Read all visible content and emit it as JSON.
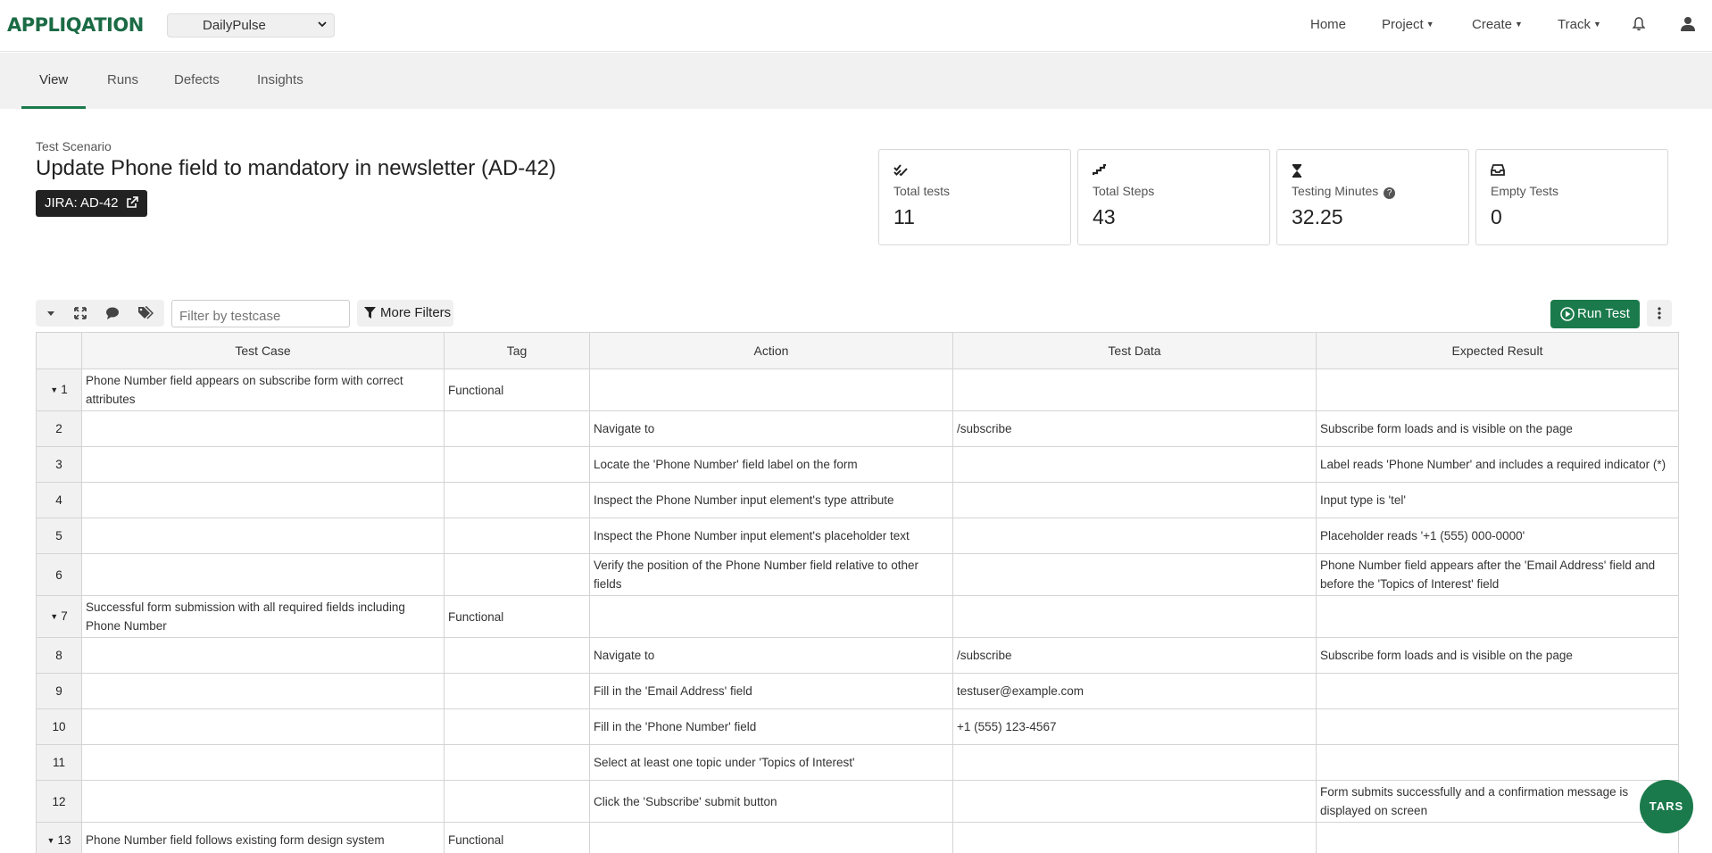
{
  "app": {
    "logo": "APPLIQATION",
    "project_selected": "DailyPulse"
  },
  "topnav": {
    "home": "Home",
    "project": "Project",
    "create": "Create",
    "track": "Track"
  },
  "subnav": [
    "View",
    "Runs",
    "Defects",
    "Insights"
  ],
  "scenario": {
    "label": "Test Scenario",
    "title": "Update Phone field to mandatory in newsletter (AD-42)",
    "jira_badge": "JIRA: AD-42"
  },
  "stats": [
    {
      "label": "Total tests",
      "value": "11",
      "icon": "check-double-icon"
    },
    {
      "label": "Total Steps",
      "value": "43",
      "icon": "stairs-icon"
    },
    {
      "label": "Testing Minutes",
      "value": "32.25",
      "icon": "hourglass-icon"
    },
    {
      "label": "Empty Tests",
      "value": "0",
      "icon": "inbox-icon"
    }
  ],
  "toolbar": {
    "filter_placeholder": "Filter by testcase",
    "more_filters": "More Filters",
    "run_test": "Run Test"
  },
  "table": {
    "headers": [
      "Test Case",
      "Tag",
      "Action",
      "Test Data",
      "Expected Result"
    ],
    "rows": [
      {
        "num": "1",
        "group": true,
        "test_case": "Phone Number field appears on subscribe form with correct attributes",
        "tag": "Functional",
        "action": "",
        "data": "",
        "expected": ""
      },
      {
        "num": "2",
        "group": false,
        "test_case": "",
        "tag": "",
        "action": "Navigate to",
        "data": "/subscribe",
        "expected": "Subscribe form loads and is visible on the page"
      },
      {
        "num": "3",
        "group": false,
        "test_case": "",
        "tag": "",
        "action": "Locate the 'Phone Number' field label on the form",
        "data": "",
        "expected": "Label reads 'Phone Number' and includes a required indicator (*)"
      },
      {
        "num": "4",
        "group": false,
        "test_case": "",
        "tag": "",
        "action": "Inspect the Phone Number input element's type attribute",
        "data": "",
        "expected": "Input type is 'tel'"
      },
      {
        "num": "5",
        "group": false,
        "test_case": "",
        "tag": "",
        "action": "Inspect the Phone Number input element's placeholder text",
        "data": "",
        "expected": "Placeholder reads '+1 (555) 000-0000'"
      },
      {
        "num": "6",
        "group": false,
        "test_case": "",
        "tag": "",
        "action": "Verify the position of the Phone Number field relative to other fields",
        "data": "",
        "expected": "Phone Number field appears after the 'Email Address' field and before the 'Topics of Interest' field"
      },
      {
        "num": "7",
        "group": true,
        "test_case": "Successful form submission with all required fields including Phone Number",
        "tag": "Functional",
        "action": "",
        "data": "",
        "expected": ""
      },
      {
        "num": "8",
        "group": false,
        "test_case": "",
        "tag": "",
        "action": "Navigate to",
        "data": "/subscribe",
        "expected": "Subscribe form loads and is visible on the page"
      },
      {
        "num": "9",
        "group": false,
        "test_case": "",
        "tag": "",
        "action": "Fill in the 'Email Address' field",
        "data": "testuser@example.com",
        "expected": ""
      },
      {
        "num": "10",
        "group": false,
        "test_case": "",
        "tag": "",
        "action": "Fill in the 'Phone Number' field",
        "data": "+1 (555) 123-4567",
        "expected": ""
      },
      {
        "num": "11",
        "group": false,
        "test_case": "",
        "tag": "",
        "action": "Select at least one topic under 'Topics of Interest'",
        "data": "",
        "expected": ""
      },
      {
        "num": "12",
        "group": false,
        "test_case": "",
        "tag": "",
        "action": "Click the 'Subscribe' submit button",
        "data": "",
        "expected": "Form submits successfully and a confirmation message is displayed on screen"
      },
      {
        "num": "13",
        "group": true,
        "test_case": "Phone Number field follows existing form design system",
        "tag": "Functional",
        "action": "",
        "data": "",
        "expected": ""
      },
      {
        "num": "",
        "group": false,
        "test_case": "",
        "tag": "",
        "action": "",
        "data": "",
        "expected": ""
      }
    ]
  },
  "fab": {
    "label": "TARS"
  },
  "colors": {
    "brand": "#1b7a4c",
    "dark_badge": "#222222"
  }
}
